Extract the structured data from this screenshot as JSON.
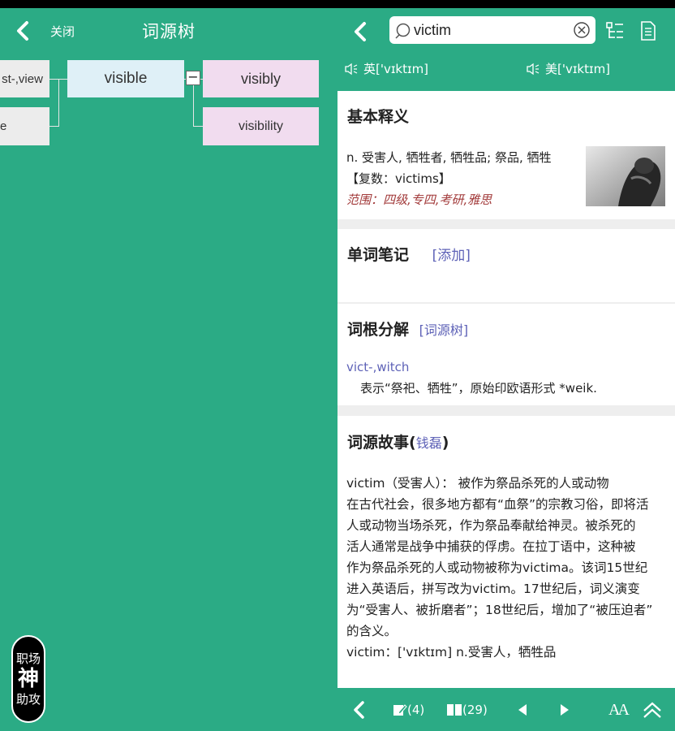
{
  "left_panel": {
    "header": {
      "close_label": "关闭",
      "title": "词源树"
    },
    "tree": {
      "left_nodes": [
        "st-,view",
        "e"
      ],
      "center_node": "visible",
      "collapse_symbol": "−",
      "right_nodes": [
        "visibly",
        "visibility"
      ]
    },
    "badge": {
      "top": "职场",
      "middle": "神",
      "bottom": "助攻"
    }
  },
  "right_panel": {
    "search": {
      "value": "victim"
    },
    "pronunciation": {
      "uk": "英['vɪktɪm]",
      "us": "美['vɪktɪm]"
    },
    "basic_meaning": {
      "title": "基本释义",
      "definition": "n. 受害人, 牺牲者, 牺牲品; 祭品, 牺牲",
      "plural": "【复数：victims】",
      "scope": "范围：四级,专四,考研,雅思"
    },
    "word_notes": {
      "title": "单词笔记",
      "add_link": "[添加]"
    },
    "root_analysis": {
      "title": "词根分解",
      "tree_link": "[词源树]",
      "root": "vict-,witch",
      "explanation": "表示“祭祀、牺牲”，原始印欧语形式 *weik."
    },
    "etymology_story": {
      "title": "词源故事",
      "author_open": "(",
      "author": "钱磊",
      "author_close": ")",
      "lines": [
        "victim（受害人）： 被作为祭品杀死的人或动物",
        "在古代社会，很多地方都有“血祭”的宗教习俗，即将活",
        "人或动物当场杀死，作为祭品奉献给神灵。被杀死的",
        "活人通常是战争中捕获的俘虏。在拉丁语中，这种被",
        "作为祭品杀死的人或动物被称为victima。该词15世纪",
        "进入英语后，拼写改为victim。17世纪后，词义演变",
        "为“受害人、被折磨者”；18世纪后，增加了“被压迫者”",
        "的含义。",
        "victim：['vɪktɪm] n.受害人，牺牲品"
      ]
    },
    "bottom_bar": {
      "notes_count": "(4)",
      "book_count": "(29)",
      "font_label": "AA"
    }
  },
  "colors": {
    "primary": "#2bab85",
    "link": "#5e62b7",
    "scope": "#a23a3a"
  }
}
